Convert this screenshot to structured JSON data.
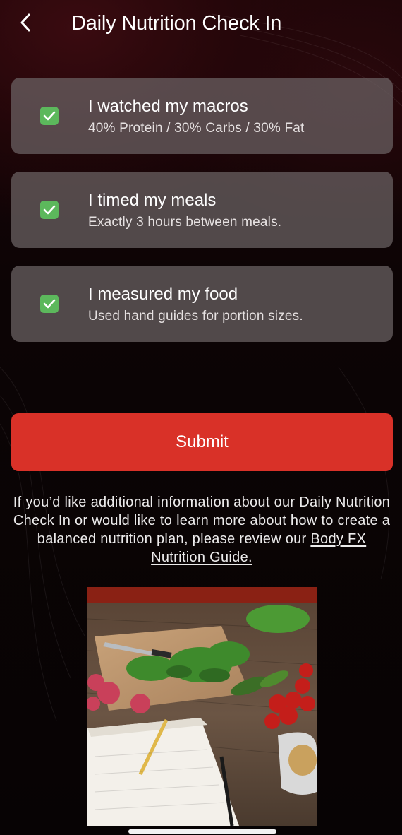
{
  "header": {
    "title": "Daily Nutrition Check In",
    "back_icon": "chevron-left-icon"
  },
  "checklist": [
    {
      "title": "I watched my macros",
      "subtitle": "40% Protein / 30% Carbs / 30% Fat",
      "checked": true
    },
    {
      "title": "I timed my meals",
      "subtitle": "Exactly 3 hours between meals.",
      "checked": true
    },
    {
      "title": "I measured my food",
      "subtitle": "Used hand guides for portion sizes.",
      "checked": true
    }
  ],
  "submit_label": "Submit",
  "info": {
    "text": "If you’d like additional information about our Daily Nutrition Check In or would like to learn more about how to create a balanced nutrition plan, please review our ",
    "link_text": "Body FX Nutrition Guide."
  },
  "colors": {
    "accent": "#d93128",
    "check": "#5cb85c",
    "card": "#6c6465"
  }
}
